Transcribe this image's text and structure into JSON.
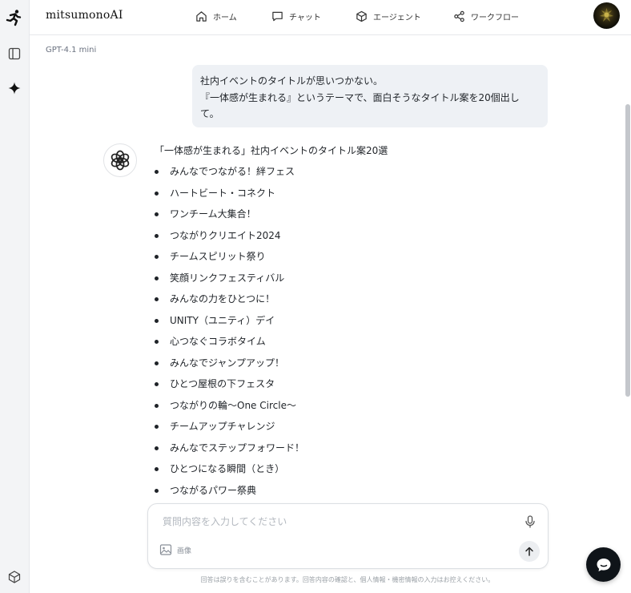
{
  "app": {
    "name": "mitsumonoAI"
  },
  "nav": [
    {
      "label": "ホーム",
      "icon": "home-icon"
    },
    {
      "label": "チャット",
      "icon": "chat-icon"
    },
    {
      "label": "エージェント",
      "icon": "agent-cube-icon"
    },
    {
      "label": "ワークフロー",
      "icon": "share-nodes-icon"
    }
  ],
  "model": "GPT-4.1 mini",
  "user_message": {
    "line1": "社内イベントのタイトルが思いつかない。",
    "line2": "『一体感が生まれる』というテーマで、面白そうなタイトル案を20個出し",
    "line3": "て。"
  },
  "answer": {
    "title": "「一体感が生まれる」社内イベントのタイトル案20選",
    "items": [
      "みんなでつながる！絆フェス",
      "ハートビート・コネクト",
      "ワンチーム大集合！",
      "つながりクリエイト2024",
      "チームスピリット祭り",
      "笑顔リンクフェスティバル",
      "みんなの力をひとつに！",
      "UNITY（ユニティ）デイ",
      "心つなぐコラボタイム",
      "みんなでジャンプアップ！",
      "ひとつ屋根の下フェスタ",
      "つながりの輪〜One Circle〜",
      "チームアップチャレンジ",
      "みんなでステップフォワード！",
      "ひとつになる瞬間（とき）",
      "つながるパワー祭典"
    ]
  },
  "composer": {
    "placeholder": "質問内容を入力してください",
    "image_label": "画像"
  },
  "disclaimer": "回答は誤りを含むことがあります。回答内容の確認と、個人情報・機密情報の入力はお控えください。",
  "colors": {
    "accent": "#0f1419",
    "bubble": "#eef1f5"
  }
}
